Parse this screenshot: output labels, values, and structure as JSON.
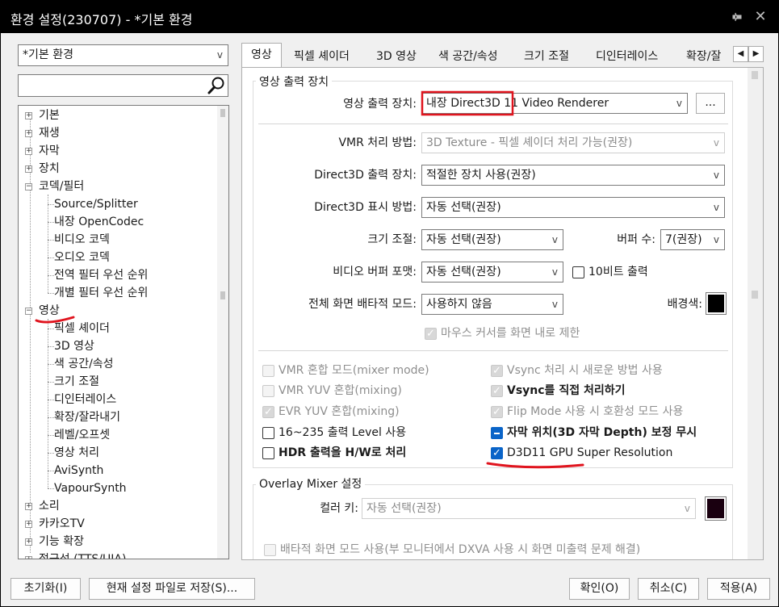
{
  "window": {
    "title": "환경 설정(230707) - *기본 환경",
    "pin_icon": "pin-icon",
    "close_icon": "close-icon"
  },
  "profile": {
    "selected": "*기본 환경"
  },
  "search": {
    "value": "",
    "placeholder": ""
  },
  "tree": {
    "items": [
      {
        "label": "기본"
      },
      {
        "label": "재생"
      },
      {
        "label": "자막"
      },
      {
        "label": "장치"
      },
      {
        "label": "코덱/필터"
      },
      {
        "label": "Source/Splitter"
      },
      {
        "label": "내장 OpenCodec"
      },
      {
        "label": "비디오 코덱"
      },
      {
        "label": "오디오 코덱"
      },
      {
        "label": "전역 필터 우선 순위"
      },
      {
        "label": "개별 필터 우선 순위"
      },
      {
        "label": "영상"
      },
      {
        "label": "픽셀 셰이더"
      },
      {
        "label": "3D 영상"
      },
      {
        "label": "색 공간/속성"
      },
      {
        "label": "크기 조절"
      },
      {
        "label": "디인터레이스"
      },
      {
        "label": "확장/잘라내기"
      },
      {
        "label": "레벨/오프셋"
      },
      {
        "label": "영상 처리"
      },
      {
        "label": "AviSynth"
      },
      {
        "label": "VapourSynth"
      },
      {
        "label": "소리"
      },
      {
        "label": "카카오TV"
      },
      {
        "label": "기능 확장"
      },
      {
        "label": "접근성 (TTS/UIA)"
      }
    ]
  },
  "tabs": [
    {
      "label": "영상"
    },
    {
      "label": "픽셀 셰이더"
    },
    {
      "label": "3D 영상"
    },
    {
      "label": "색 공간/속성"
    },
    {
      "label": "크기 조절"
    },
    {
      "label": "디인터레이스"
    },
    {
      "label": "확장/잘"
    }
  ],
  "output_group": {
    "title": "영상 출력 장치",
    "device_label": "영상 출력 장치:",
    "device_value": "내장 Direct3D 11 Video Renderer",
    "more_button": "...",
    "vmr_label": "VMR 처리 방법:",
    "vmr_value": "3D Texture - 픽셀 셰이더 처리 가능(권장)",
    "d3d_device_label": "Direct3D 출력 장치:",
    "d3d_device_value": "적절한 장치 사용(권장)",
    "d3d_display_label": "Direct3D 표시 방법:",
    "d3d_display_value": "자동 선택(권장)",
    "resize_label": "크기 조절:",
    "resize_value": "자동 선택(권장)",
    "buffer_label": "버퍼 수:",
    "buffer_value": "7(권장)",
    "video_buffer_label": "비디오 버퍼 포맷:",
    "video_buffer_value": "자동 선택(권장)",
    "tenbit_label": "10비트 출력",
    "fullscreen_label": "전체 화면 배타적 모드:",
    "fullscreen_value": "사용하지 않음",
    "bg_color_label": "배경색:",
    "bg_color": "#000000",
    "mouse_cursor_label": "마우스 커서를 화면 내로 제한"
  },
  "options": {
    "vmr_mixer": "VMR 혼합 모드(mixer mode)",
    "vmr_yuv": "VMR YUV 혼합(mixing)",
    "evr_yuv": "EVR YUV 혼합(mixing)",
    "level_16_235": "16~235 출력 Level 사용",
    "hdr_hw": "HDR 출력을 H/W로 처리",
    "vsync_new": "Vsync 처리 시 새로운 방법 사용",
    "vsync_direct": "Vsync를 직접 처리하기",
    "flip_mode": "Flip Mode 사용 시 호환성 모드 사용",
    "subtitle_depth": "자막 위치(3D 자막 Depth) 보정 무시",
    "super_resolution": "D3D11 GPU Super Resolution"
  },
  "overlay_group": {
    "title": "Overlay Mixer 설정",
    "color_key_label": "컬러 키:",
    "color_key_value": "자동 선택(권장)",
    "color_key_swatch": "#1a0010",
    "exclusive_label": "배타적 화면 모드 사용(부 모니터에서 DXVA 사용 시 화면 미출력 문제 해결)"
  },
  "footer": {
    "reset": "초기화(I)",
    "save_current": "현재 설정 파일로 저장(S)...",
    "ok": "확인(O)",
    "cancel": "취소(C)",
    "apply": "적용(A)"
  },
  "colors": {
    "accent": "#0a64c8",
    "annotation": "#e0141e"
  }
}
